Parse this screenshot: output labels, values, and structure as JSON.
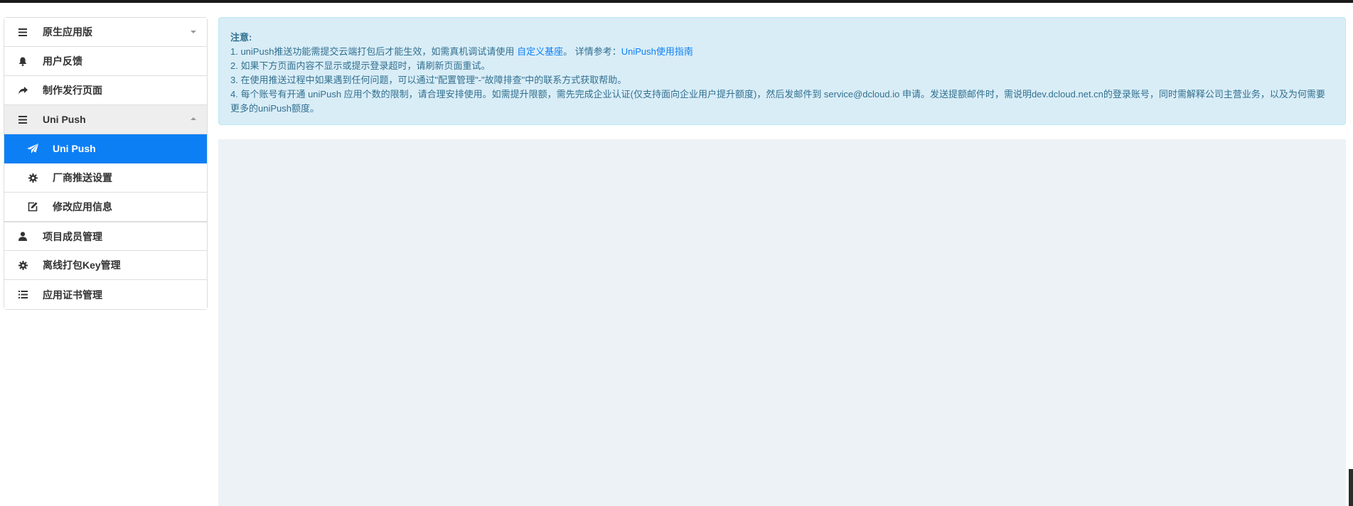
{
  "colors": {
    "accent": "#0d7ff5",
    "notice_bg": "#d9edf7",
    "notice_text": "#31708f",
    "panel_bg": "#edf2f6"
  },
  "sidebar": {
    "items": [
      {
        "label": "原生应用版",
        "icon": "list-icon",
        "caret": "down"
      },
      {
        "label": "用户反馈",
        "icon": "bell-icon"
      },
      {
        "label": "制作发行页面",
        "icon": "share-arrow-icon"
      },
      {
        "label": "Uni Push",
        "icon": "list-icon",
        "caret": "up",
        "expanded": true,
        "children": [
          {
            "label": "Uni Push",
            "icon": "send-icon",
            "active": true
          },
          {
            "label": "厂商推送设置",
            "icon": "gear-icon"
          },
          {
            "label": "修改应用信息",
            "icon": "edit-icon"
          }
        ]
      },
      {
        "label": "项目成员管理",
        "icon": "user-icon"
      },
      {
        "label": "离线打包Key管理",
        "icon": "gear-icon"
      },
      {
        "label": "应用证书管理",
        "icon": "bulleted-list-icon"
      }
    ]
  },
  "notice": {
    "title": "注意:",
    "line1_prefix": "1. uniPush推送功能需提交云端打包后才能生效，如需真机调试请使用",
    "line1_link1": "自定义基座",
    "line1_mid": "。 详情参考：",
    "line1_link2": "UniPush使用指南",
    "line2": "2. 如果下方页面内容不显示或提示登录超时，请刷新页面重试。",
    "line3": "3. 在使用推送过程中如果遇到任何问题，可以通过\"配置管理\"-\"故障排查\"中的联系方式获取帮助。",
    "line4": "4. 每个账号有开通 uniPush 应用个数的限制，请合理安排使用。如需提升限额，需先完成企业认证(仅支持面向企业用户提升额度)，然后发邮件到 service@dcloud.io 申请。发送提额邮件时，需说明dev.dcloud.net.cn的登录账号，同时需解释公司主营业务，以及为何需要更多的uniPush额度。"
  }
}
